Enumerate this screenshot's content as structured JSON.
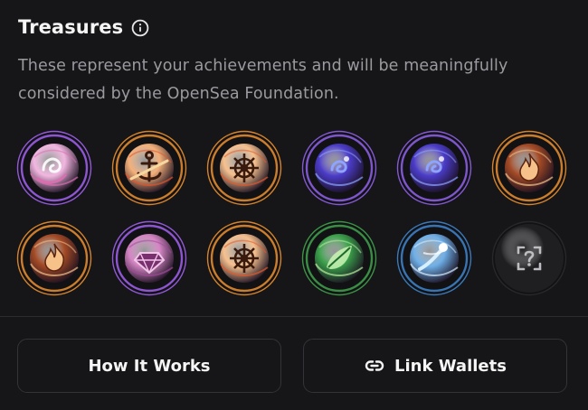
{
  "treasures": {
    "title": "Treasures",
    "description": "These represent your achievements and will be meaningfully considered by the OpenSea Foundation.",
    "info_icon": "info-circle-icon",
    "badges": [
      {
        "name": "pink-swirl-treasure",
        "ring": "#9b5de5",
        "core": "#f2b6e0",
        "accent": "#d96fb0",
        "glyph": "swirl"
      },
      {
        "name": "anchor-treasure",
        "ring": "#e08a2e",
        "core": "#f4b07a",
        "accent": "#e2562c",
        "glyph": "anchor"
      },
      {
        "name": "ship-wheel-treasure",
        "ring": "#e08a2e",
        "core": "#f6c08e",
        "accent": "#e25a2c",
        "glyph": "wheel"
      },
      {
        "name": "indigo-vortex-treasure",
        "ring": "#8a5de0",
        "core": "#4b3cc9",
        "accent": "#8ea4ff",
        "glyph": "vortex"
      },
      {
        "name": "indigo-vortex-treasure-2",
        "ring": "#8a5de0",
        "core": "#4b3cc9",
        "accent": "#8ea4ff",
        "glyph": "vortex"
      },
      {
        "name": "flame-treasure",
        "ring": "#e08a2e",
        "core": "#a44a25",
        "accent": "#f6c28a",
        "glyph": "flame"
      },
      {
        "name": "flame-treasure-2",
        "ring": "#e08a2e",
        "core": "#a44a25",
        "accent": "#f6c28a",
        "glyph": "flame"
      },
      {
        "name": "gem-treasure",
        "ring": "#9b5de5",
        "core": "#d585c4",
        "accent": "#a14a9a",
        "glyph": "gem"
      },
      {
        "name": "ship-wheel-treasure-2",
        "ring": "#e08a2e",
        "core": "#f6c08e",
        "accent": "#e25a2c",
        "glyph": "wheel"
      },
      {
        "name": "green-orb-treasure",
        "ring": "#3f9b4a",
        "core": "#3aa04a",
        "accent": "#b8f0a0",
        "glyph": "leaf"
      },
      {
        "name": "blue-orb-treasure",
        "ring": "#3d7fc4",
        "core": "#6fb0e8",
        "accent": "#d7efff",
        "glyph": "comet"
      },
      {
        "name": "locked-mystery-treasure",
        "ring": "#2a2a2e",
        "core": "#1f1f22",
        "accent": "#bdbdc2",
        "glyph": "mystery"
      }
    ]
  },
  "actions": {
    "how_it_works_label": "How It Works",
    "link_wallets_label": "Link Wallets",
    "link_wallets_icon": "link-icon"
  }
}
